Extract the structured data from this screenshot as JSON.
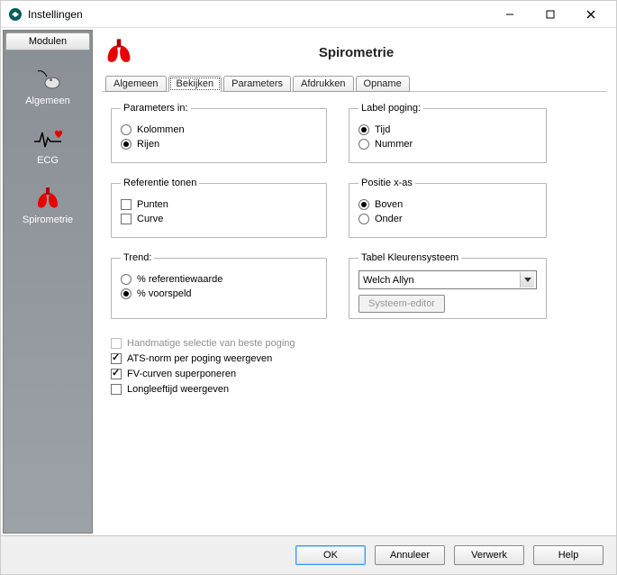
{
  "window": {
    "title": "Instellingen"
  },
  "sidebar": {
    "tab_label": "Modulen",
    "items": [
      {
        "label": "Algemeen"
      },
      {
        "label": "ECG"
      },
      {
        "label": "Spirometrie"
      }
    ]
  },
  "page": {
    "title": "Spirometrie"
  },
  "tabs": {
    "items": [
      {
        "label": "Algemeen"
      },
      {
        "label": "Bekijken"
      },
      {
        "label": "Parameters"
      },
      {
        "label": "Afdrukken"
      },
      {
        "label": "Opname"
      }
    ],
    "active_index": 1
  },
  "groups": {
    "parameters_in": {
      "legend": "Parameters in:",
      "options": [
        {
          "label": "Kolommen",
          "checked": false
        },
        {
          "label": "Rijen",
          "checked": true
        }
      ]
    },
    "label_poging": {
      "legend": "Label poging:",
      "options": [
        {
          "label": "Tijd",
          "checked": true
        },
        {
          "label": "Nummer",
          "checked": false
        }
      ]
    },
    "referentie_tonen": {
      "legend": "Referentie tonen",
      "options": [
        {
          "label": "Punten",
          "checked": false
        },
        {
          "label": "Curve",
          "checked": false
        }
      ]
    },
    "positie_xas": {
      "legend": "Positie x-as",
      "options": [
        {
          "label": "Boven",
          "checked": true
        },
        {
          "label": "Onder",
          "checked": false
        }
      ]
    },
    "trend": {
      "legend": "Trend:",
      "options": [
        {
          "label": "% referentiewaarde",
          "checked": false
        },
        {
          "label": "% voorspeld",
          "checked": true
        }
      ]
    },
    "kleurensysteem": {
      "legend": "Tabel Kleurensysteem",
      "selected": "Welch Allyn",
      "editor_button": "Systeem-editor"
    }
  },
  "checks": {
    "handmatige": {
      "label": "Handmatige selectie van beste poging",
      "checked": false,
      "disabled": true
    },
    "atsnorm": {
      "label": "ATS-norm per poging weergeven",
      "checked": true
    },
    "fvcurven": {
      "label": "FV-curven superponeren",
      "checked": true
    },
    "longleeftijd": {
      "label": "Longleeftijd weergeven",
      "checked": false
    }
  },
  "buttons": {
    "ok": "OK",
    "annuleer": "Annuleer",
    "verwerk": "Verwerk",
    "help": "Help"
  }
}
